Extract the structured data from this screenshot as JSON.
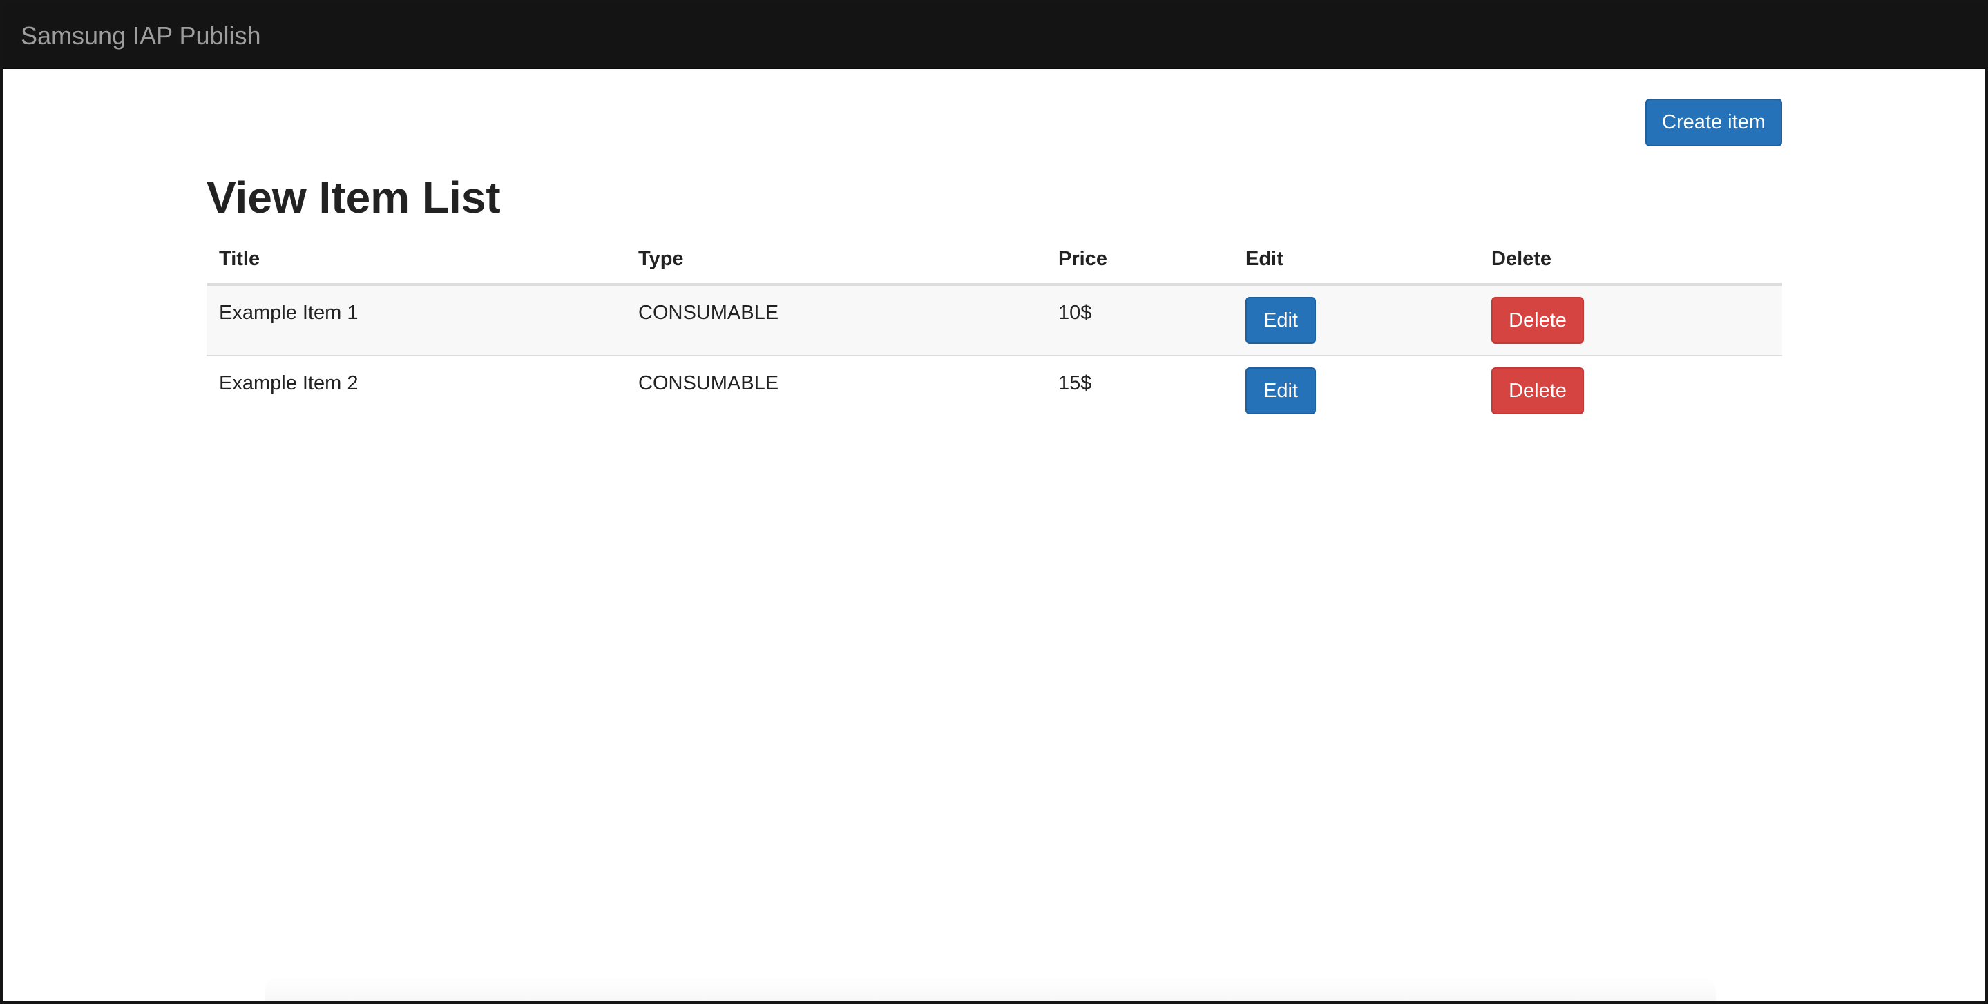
{
  "navbar": {
    "brand": "Samsung IAP Publish"
  },
  "toolbar": {
    "create_label": "Create item"
  },
  "page": {
    "title": "View Item List"
  },
  "table": {
    "headers": {
      "title": "Title",
      "type": "Type",
      "price": "Price",
      "edit": "Edit",
      "delete": "Delete"
    },
    "rows": [
      {
        "title": "Example Item 1",
        "type": "CONSUMABLE",
        "price": "10$",
        "edit_label": "Edit",
        "delete_label": "Delete"
      },
      {
        "title": "Example Item 2",
        "type": "CONSUMABLE",
        "price": "15$",
        "edit_label": "Edit",
        "delete_label": "Delete"
      }
    ]
  },
  "colors": {
    "navbar": "#141414",
    "brand_text": "#9d9d9d",
    "primary": "#2672b8",
    "danger": "#d54441",
    "stripe": "#f8f8f8",
    "border": "#dddddd"
  }
}
